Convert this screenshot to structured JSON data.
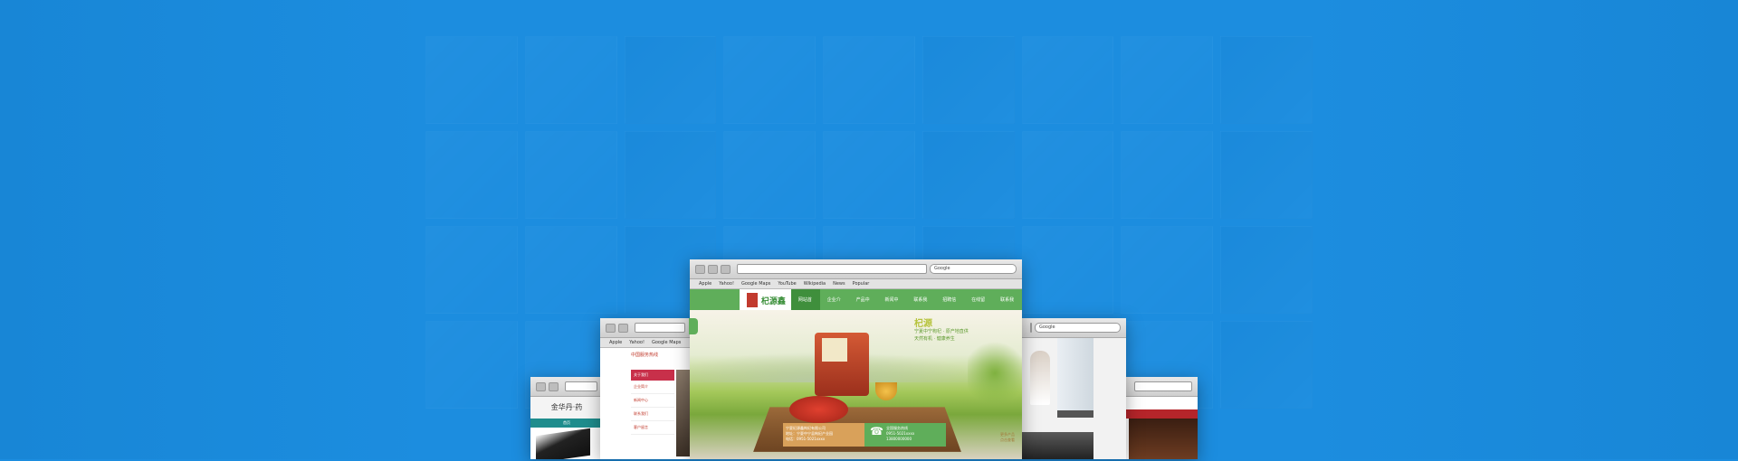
{
  "main_window": {
    "bookmarks": [
      "Apple",
      "Yahoo!",
      "Google Maps",
      "YouTube",
      "Wikipedia",
      "News",
      "Popular"
    ],
    "search_placeholder": "Google",
    "logo_text": "杞源鑫",
    "nav": [
      "网站首页",
      "企业介绍",
      "产品中心",
      "新闻中心",
      "联系我们",
      "招聘信息",
      "在线留言",
      "联系我们"
    ],
    "slogan_big": "杞源",
    "slogan_lines": [
      "宁夏中宁枸杞 · 原产地直供",
      "天然有机 · 健康养生"
    ],
    "info_lines": [
      "宁夏杞源鑫枸杞有限公司",
      "地址：宁夏中宁县枸杞产业园",
      "电话：0951-5021xxxx"
    ],
    "phone_title": "全国服务热线",
    "phone_numbers": [
      "0951-5021xxxx",
      "13800000000"
    ],
    "side_tag_lines": [
      "更多产品",
      "点击查看"
    ]
  },
  "left_window": {
    "brand": "中国服务热线",
    "menu_active": "关于我们",
    "menu_items": [
      "企业简介",
      "新闻中心",
      "联系我们",
      "客户留言"
    ]
  },
  "far_left_window": {
    "title": "金华丹·药",
    "bar": "首页"
  },
  "colors": {
    "background": "#1c8ddf",
    "green": "#5fae5a",
    "accent_red": "#c8304a"
  }
}
